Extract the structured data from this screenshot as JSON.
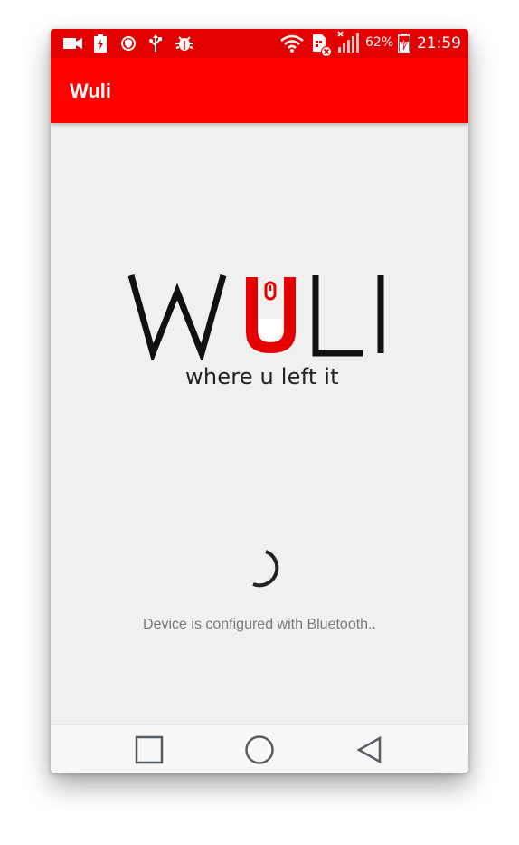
{
  "status_bar": {
    "battery_percent": "62%",
    "time": "21:59",
    "icons": [
      "video-camera-icon",
      "battery-charging-icon",
      "shield-icon",
      "usb-icon",
      "android-debug-icon",
      "wifi-icon",
      "sim-error-icon",
      "signal-icon",
      "battery-icon"
    ]
  },
  "app_bar": {
    "title": "Wuli"
  },
  "logo": {
    "wordmark": "WULI",
    "tagline": "where u left it",
    "accent_color": "#e60000"
  },
  "loading": {
    "message": "Device is configured with Bluetooth.."
  },
  "nav_bar": {
    "buttons": [
      "recents-button",
      "home-button",
      "back-button"
    ]
  },
  "colors": {
    "status_bar": "#e20000",
    "app_bar": "#fe0000",
    "background": "#f0f0f0"
  }
}
